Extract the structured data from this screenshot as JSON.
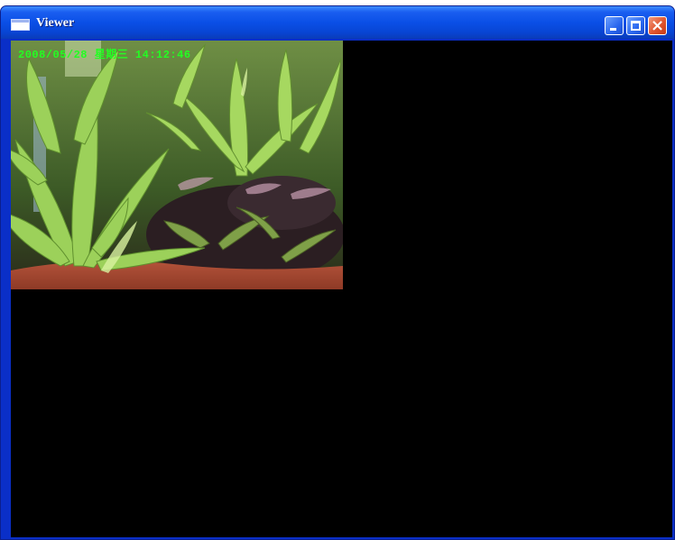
{
  "window": {
    "title": "Viewer",
    "icon": "app-window-icon",
    "controls": [
      "minimize-icon",
      "maximize-icon",
      "close-icon"
    ],
    "colors": {
      "titlebar": "#0a4fe6",
      "close": "#e0552f",
      "client": "#000000"
    }
  },
  "video": {
    "osd_text": "2008/05/28 星期三 14:12:46",
    "osd_color": "#22ff22",
    "content": "aquarium plants camera feed"
  }
}
